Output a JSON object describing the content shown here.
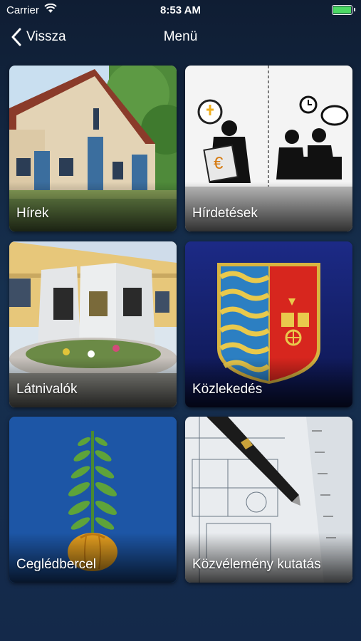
{
  "status_bar": {
    "carrier": "Carrier",
    "time": "8:53 AM"
  },
  "navbar": {
    "back_label": "Vissza",
    "title": "Menü"
  },
  "menu": {
    "items": [
      {
        "label": "Hírek",
        "icon": "town-hall-photo"
      },
      {
        "label": "Hírdetések",
        "icon": "advertisement-illustration"
      },
      {
        "label": "Látnivalók",
        "icon": "monument-photo"
      },
      {
        "label": "Közlekedés",
        "icon": "coat-of-arms"
      },
      {
        "label": "Ceglédbercel",
        "icon": "plant-emblem"
      },
      {
        "label": "Közvélemény kutatás",
        "icon": "pen-blueprint-photo"
      }
    ]
  },
  "colors": {
    "background": "#14294a",
    "battery": "#4cd964"
  }
}
